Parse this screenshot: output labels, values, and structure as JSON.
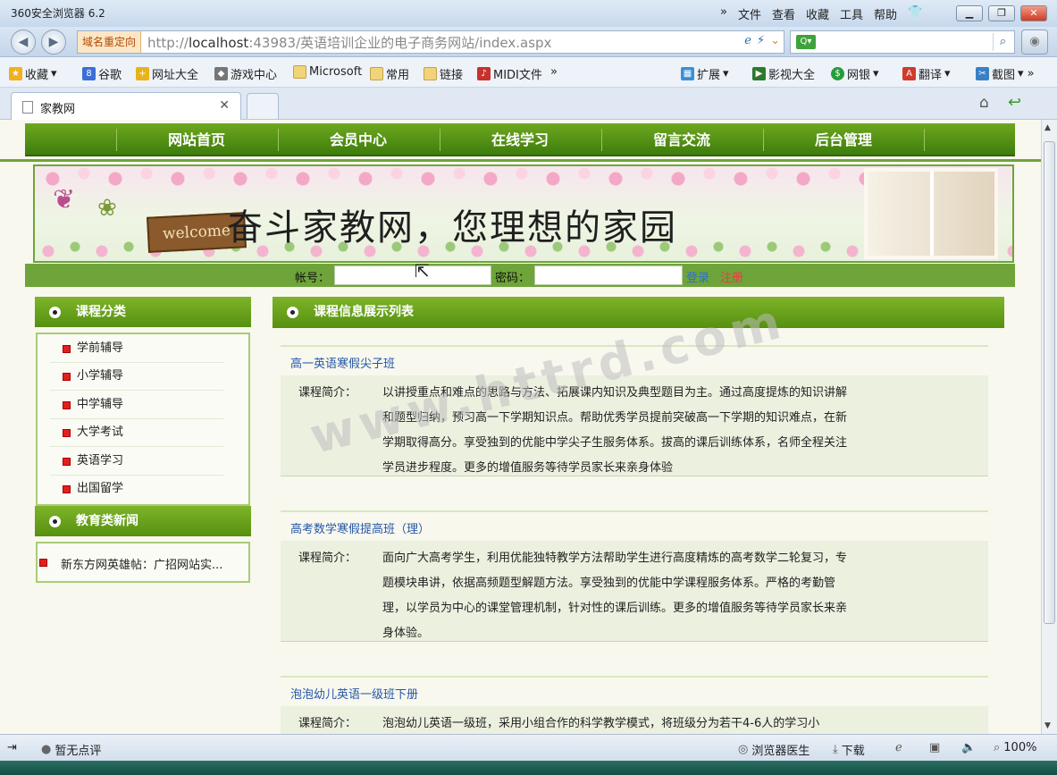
{
  "browser": {
    "title": "360安全浏览器 6.2",
    "menu": [
      "»",
      "文件",
      "查看",
      "收藏",
      "工具",
      "帮助"
    ],
    "redirect_label": "域名重定向",
    "url_prefix": "http://",
    "url_host": "localhost",
    "url_rest": ":43983/英语培训企业的电子商务网站/index.aspx",
    "search_placeholder": "",
    "favorites": [
      "收藏",
      "谷歌",
      "网址大全",
      "游戏中心",
      "Microsoft",
      "常用",
      "链接",
      "MIDI文件",
      "»"
    ],
    "tools": [
      "扩展",
      "影视大全",
      "网银",
      "翻译",
      "截图"
    ],
    "tab_label": "家教网",
    "status_left": "暂无点评",
    "status_doctor": "浏览器医生",
    "status_download": "下载",
    "zoom": "100%"
  },
  "site": {
    "nav": [
      "网站首页",
      "会员中心",
      "在线学习",
      "留言交流",
      "后台管理"
    ],
    "banner_slogan": "奋斗家教网，您理想的家园",
    "banner_welcome": "welcome",
    "login": {
      "account_label": "帐号：",
      "password_label": "密码：",
      "login_link": "登录",
      "register_link": "注册"
    },
    "categories_title": "课程分类",
    "categories": [
      "学前辅导",
      "小学辅导",
      "中学辅导",
      "大学考试",
      "英语学习",
      "出国留学"
    ],
    "news_title": "教育类新闻",
    "news": [
      "新东方网英雄帖：广招网站实..."
    ],
    "main_title": "课程信息展示列表",
    "intro_label": "课程简介：",
    "courses": [
      {
        "title": "高一英语寒假尖子班",
        "desc": "以讲授重点和难点的思路与方法、拓展课内知识及典型题目为主。通过高度提炼的知识讲解和题型归纳，预习高一下学期知识点。帮助优秀学员提前突破高一下学期的知识难点，在新学期取得高分。享受独到的优能中学尖子生服务体系。拔高的课后训练体系，名师全程关注学员进步程度。更多的增值服务等待学员家长来亲身体验"
      },
      {
        "title": "高考数学寒假提高班（理）",
        "desc": "面向广大高考学生，利用优能独特教学方法帮助学生进行高度精炼的高考数学二轮复习，专题模块串讲，依据高频题型解题方法。享受独到的优能中学课程服务体系。严格的考勤管理，以学员为中心的课堂管理机制，针对性的课后训练。更多的增值服务等待学员家长来亲身体验。"
      },
      {
        "title": "泡泡幼儿英语一级班下册",
        "desc": "泡泡幼儿英语一级班，采用小组合作的科学教学模式，将班级分为若干4-6人的学习小"
      }
    ],
    "watermark": "www.httrd.com"
  }
}
